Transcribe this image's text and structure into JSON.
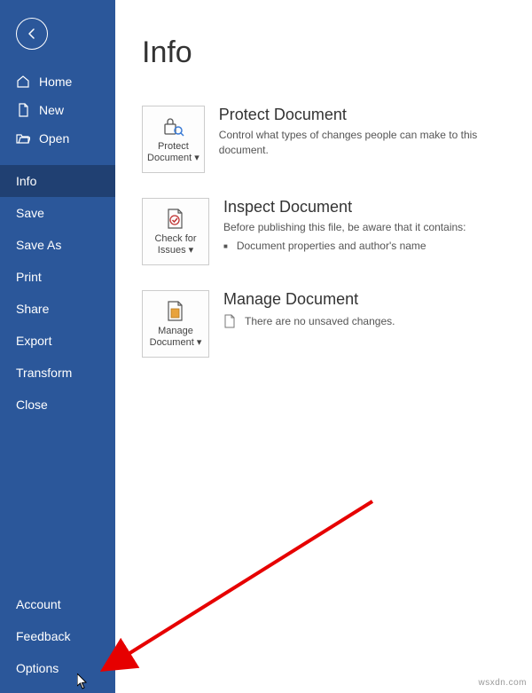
{
  "page_title": "Info",
  "sidebar": {
    "primary": [
      {
        "label": "Home",
        "icon": "home"
      },
      {
        "label": "New",
        "icon": "document"
      },
      {
        "label": "Open",
        "icon": "folder"
      }
    ],
    "secondary": [
      {
        "label": "Info",
        "selected": true
      },
      {
        "label": "Save"
      },
      {
        "label": "Save As"
      },
      {
        "label": "Print"
      },
      {
        "label": "Share"
      },
      {
        "label": "Export"
      },
      {
        "label": "Transform"
      },
      {
        "label": "Close"
      }
    ],
    "footer": [
      {
        "label": "Account"
      },
      {
        "label": "Feedback"
      },
      {
        "label": "Options"
      }
    ]
  },
  "sections": {
    "protect": {
      "tile_label": "Protect Document",
      "title": "Protect Document",
      "desc": "Control what types of changes people can make to this document."
    },
    "inspect": {
      "tile_label": "Check for Issues",
      "title": "Inspect Document",
      "desc": "Before publishing this file, be aware that it contains:",
      "bullet": "Document properties and author's name"
    },
    "manage": {
      "tile_label": "Manage Document",
      "title": "Manage Document",
      "desc": "There are no unsaved changes."
    }
  },
  "watermark": "wsxdn.com"
}
